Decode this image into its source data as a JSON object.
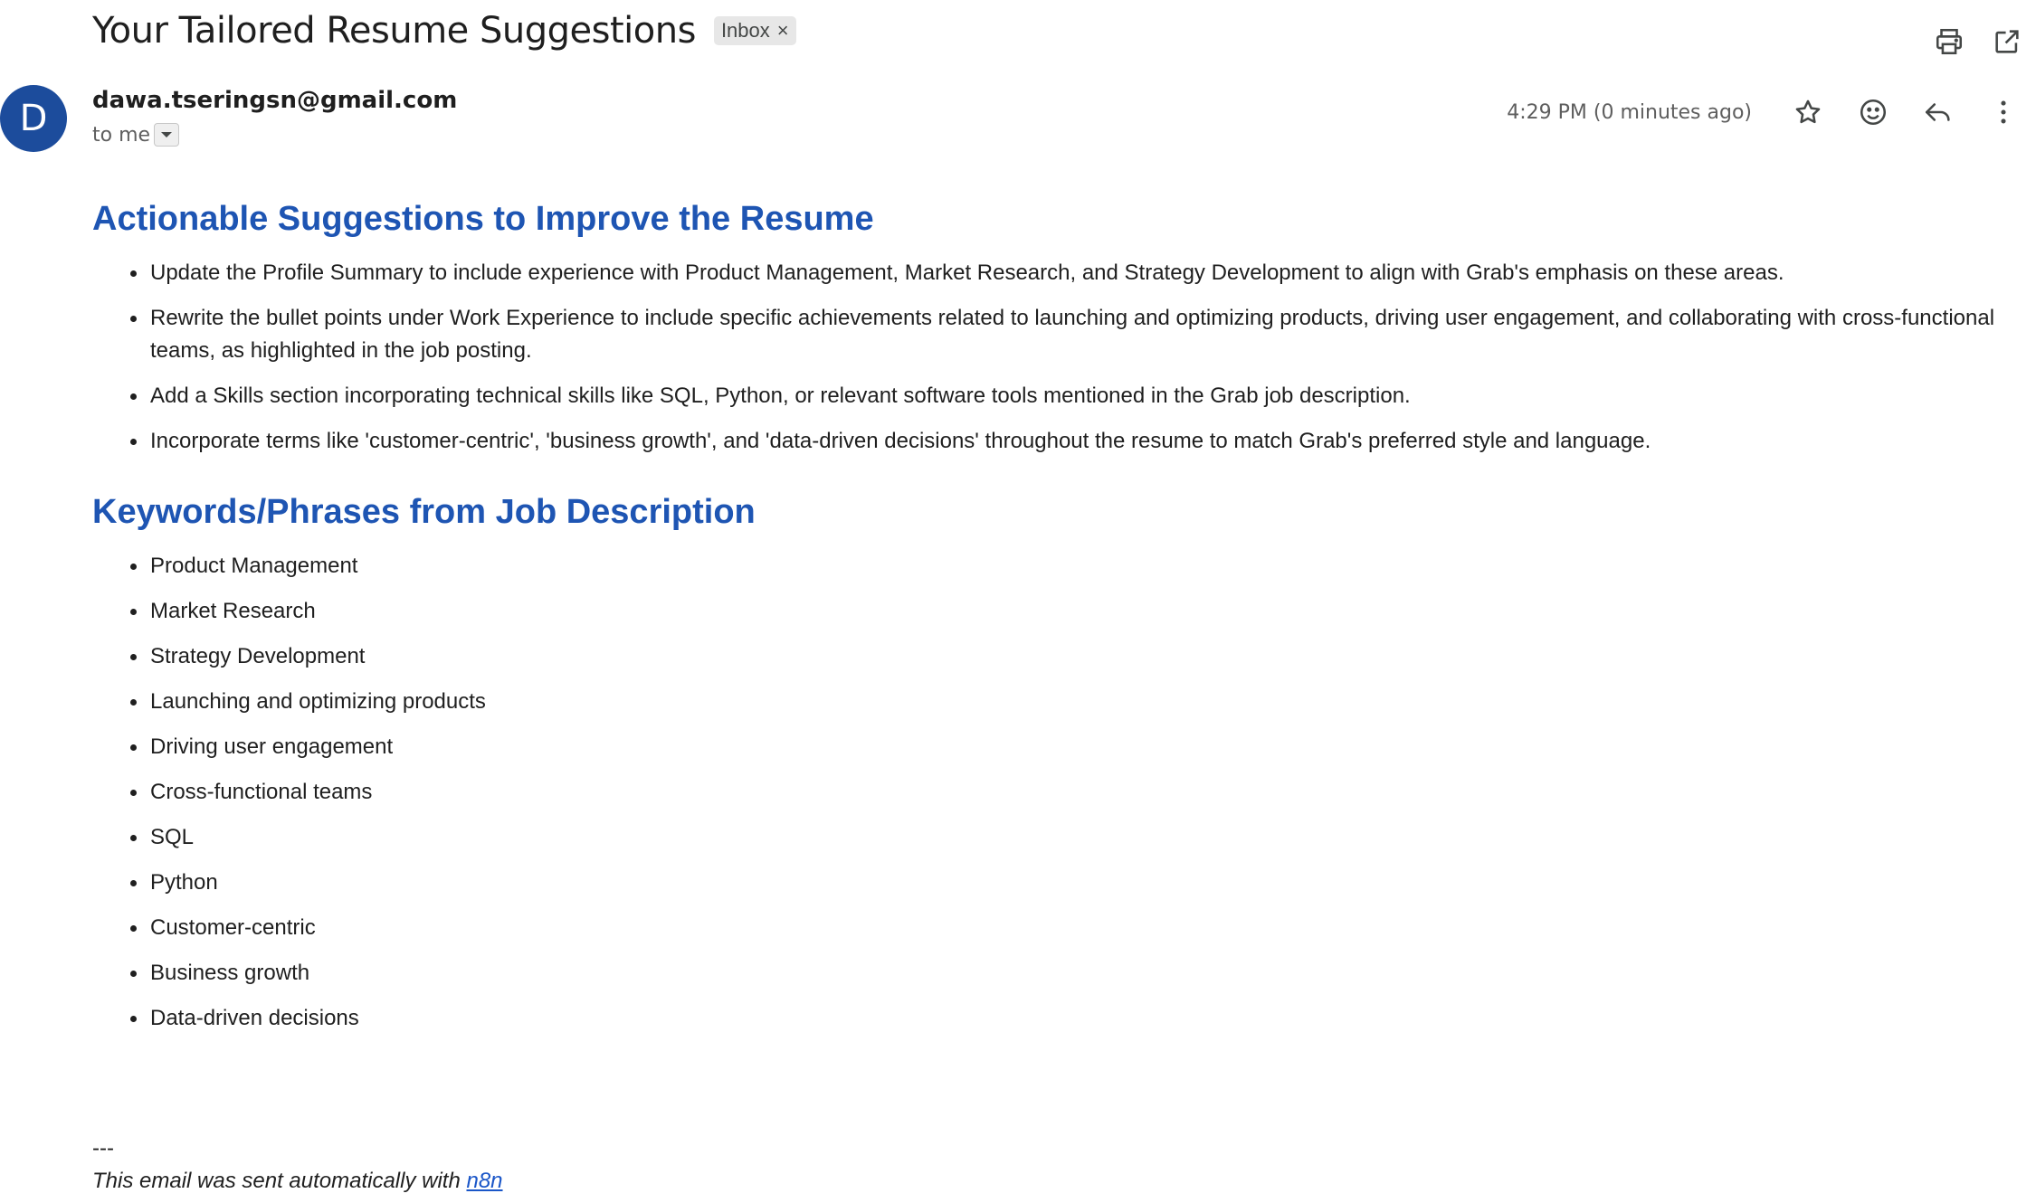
{
  "email": {
    "subject": "Your Tailored Resume Suggestions",
    "label": "Inbox",
    "label_remove": "×",
    "avatar_letter": "D",
    "sender": "dawa.tseringsn@gmail.com",
    "recipient": "to me",
    "timestamp": "4:29 PM (0 minutes ago)"
  },
  "icons": {
    "print": "print-icon",
    "open_new_window": "open-in-new-window-icon",
    "star": "star-icon",
    "emoji": "emoji-reaction-icon",
    "reply": "reply-icon",
    "more": "more-vertical-icon",
    "expand_details": "caret-down-icon"
  },
  "colors": {
    "heading": "#1e55b3",
    "avatar": "#1c4c9c",
    "link": "#1a56c8"
  },
  "body": {
    "sections": [
      {
        "heading": "Actionable Suggestions to Improve the Resume",
        "items": [
          "Update the Profile Summary to include experience with Product Management, Market Research, and Strategy Development to align with Grab's emphasis on these areas.",
          "Rewrite the bullet points under Work Experience to include specific achievements related to launching and optimizing products, driving user engagement, and collaborating with cross-functional teams, as highlighted in the job posting.",
          "Add a Skills section incorporating technical skills like SQL, Python, or relevant software tools mentioned in the Grab job description.",
          "Incorporate terms like 'customer-centric', 'business growth', and 'data-driven decisions' throughout the resume to match Grab's preferred style and language."
        ]
      },
      {
        "heading": "Keywords/Phrases from Job Description",
        "items": [
          "Product Management",
          "Market Research",
          "Strategy Development",
          "Launching and optimizing products",
          "Driving user engagement",
          "Cross-functional teams",
          "SQL",
          "Python",
          "Customer-centric",
          "Business growth",
          "Data-driven decisions"
        ]
      }
    ],
    "footer": {
      "separator": "---",
      "signature_text": "This email was sent automatically with ",
      "link_text": "n8n"
    }
  }
}
